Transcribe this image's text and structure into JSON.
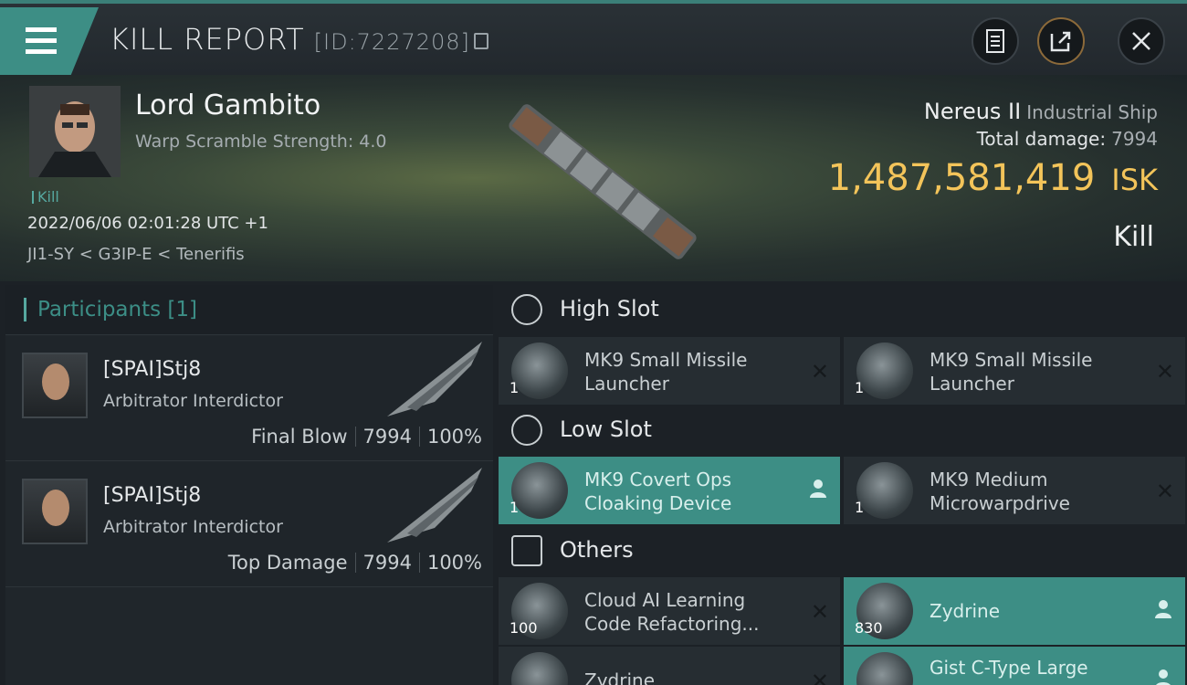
{
  "titlebar": {
    "title": "KILL REPORT",
    "id": "[ID:7227208]"
  },
  "victim": {
    "name": "Lord Gambito",
    "warp": "Warp Scramble Strength: 4.0",
    "tag": "Kill",
    "date": "2022/06/06 02:01:28 UTC +1",
    "route": "JI1-SY < G3IP-E < Tenerifis",
    "ship_name": "Nereus II",
    "ship_class": "Industrial Ship",
    "total_damage_label": "Total damage:",
    "total_damage": "7994",
    "isk": "1,487,581,419",
    "isk_unit": "ISK",
    "result": "Kill"
  },
  "participants": {
    "title": "Participants [1]",
    "rows": [
      {
        "name": "[SPAI]Stj8",
        "ship": "Arbitrator Interdictor",
        "role": "Final Blow",
        "damage": "7994",
        "pct": "100%"
      },
      {
        "name": "[SPAI]Stj8",
        "ship": "Arbitrator Interdictor",
        "role": "Top Damage",
        "damage": "7994",
        "pct": "100%"
      }
    ]
  },
  "fitting": {
    "high": {
      "label": "High Slot",
      "items": [
        {
          "name": "MK9 Small Missile Launcher",
          "qty": "1"
        },
        {
          "name": "MK9 Small Missile Launcher",
          "qty": "1"
        }
      ]
    },
    "low": {
      "label": "Low Slot",
      "items": [
        {
          "name": "MK9 Covert Ops Cloaking Device",
          "qty": "1"
        },
        {
          "name": "MK9 Medium Microwarpdrive",
          "qty": "1"
        }
      ]
    },
    "others": {
      "label": "Others",
      "items": [
        {
          "name": "Cloud AI Learning Code Refactoring...",
          "qty": "100"
        },
        {
          "name": "Zydrine",
          "qty": "830"
        },
        {
          "name": "Zydrine",
          "qty": ""
        },
        {
          "name": "Gist C-Type Large",
          "qty": ""
        }
      ]
    }
  },
  "colors": {
    "accent": "#3d8e85",
    "isk": "#f3c45a"
  },
  "icons": [
    "menu-icon",
    "copy-icon",
    "clipboard-icon",
    "share-icon",
    "close-icon",
    "slot-icon",
    "box-icon",
    "remove-icon",
    "user-icon"
  ]
}
